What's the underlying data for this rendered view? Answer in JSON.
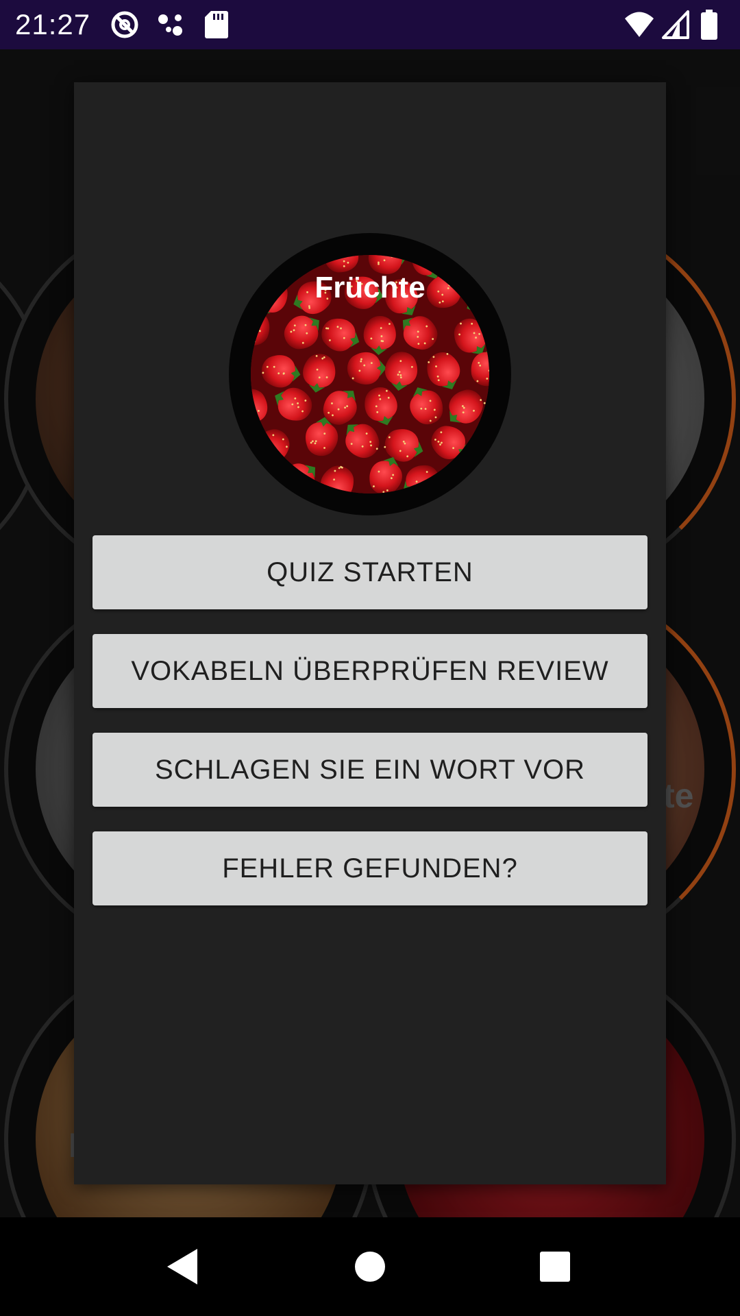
{
  "status_bar": {
    "time": "21:27",
    "left_icons": [
      "do-not-disturb-icon",
      "assistant-dots-icon",
      "sd-card-icon"
    ],
    "right_icons": [
      "wifi-icon",
      "cell-signal-icon",
      "battery-icon"
    ]
  },
  "background": {
    "partial_label_right": "te",
    "partial_label_left": "I"
  },
  "dialog": {
    "title": "Früchte",
    "image_icon": "strawberries-image",
    "buttons": {
      "start_quiz": "QUIZ STARTEN",
      "review": "VOKABELN ÜBERPRÜFEN REVIEW",
      "suggest_word": "SCHLAGEN SIE EIN WORT VOR",
      "report_error": "FEHLER GEFUNDEN?"
    }
  },
  "nav_bar": {
    "icons": [
      "back-icon",
      "home-icon",
      "recents-icon"
    ]
  },
  "colors": {
    "status_bar": "#1c0b3e",
    "dialog_bg": "#212121",
    "button_bg": "#d6d7d7",
    "button_text": "#1f1f1f",
    "accent_ring": "#e0641c"
  }
}
